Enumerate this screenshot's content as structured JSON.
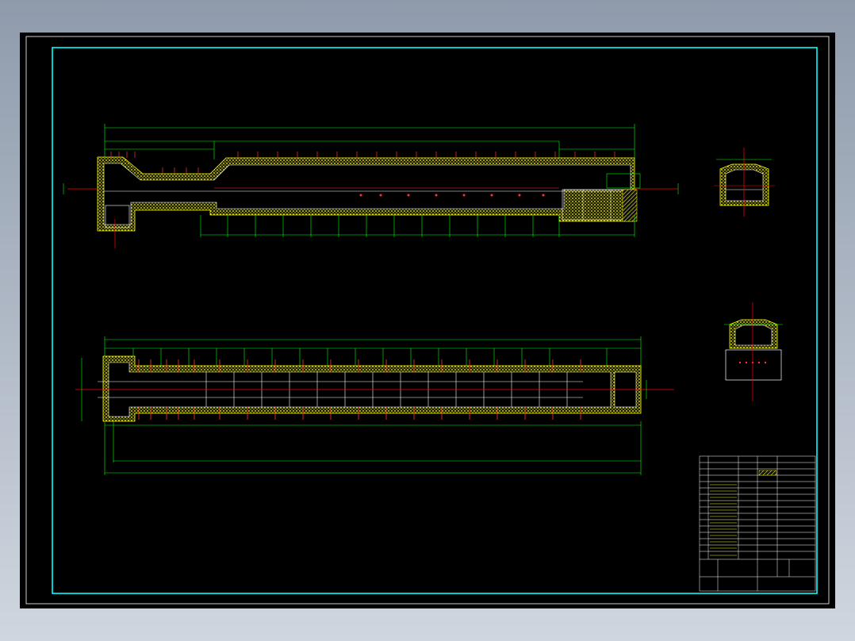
{
  "title_block": {
    "drawing_title": "",
    "designer": "",
    "checker": "",
    "approver": "",
    "scale": "",
    "sheet": ""
  },
  "colors": {
    "background": "#000000",
    "frame": "#00ffff",
    "insulation": "#ffff00",
    "dimension": "#00ff00",
    "centerline": "#ff0000",
    "wall": "#ffffff"
  }
}
